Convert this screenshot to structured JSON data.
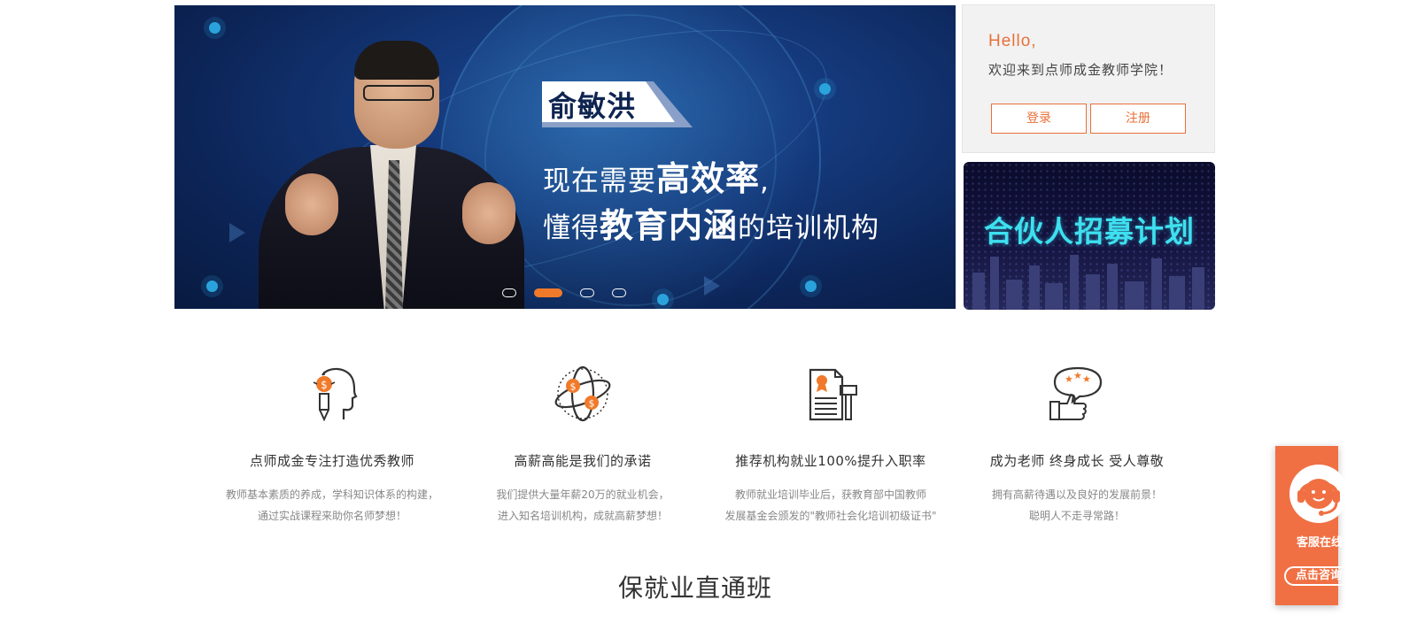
{
  "banner": {
    "name": "俞敏洪",
    "slogan_line1_pre": "现在需要",
    "slogan_line1_bold": "高效率",
    "slogan_line1_post": ",",
    "slogan_line2_pre": "懂得",
    "slogan_line2_bold": "教育内涵",
    "slogan_line2_post": "的培训机构",
    "slides": 4,
    "active_slide": 2
  },
  "login": {
    "hello": "Hello,",
    "welcome": "欢迎来到点师成金教师学院！",
    "login_label": "登录",
    "register_label": "注册"
  },
  "partner": {
    "title": "合伙人招募计划"
  },
  "features": [
    {
      "icon": "head-idea-icon",
      "title": "点师成金专注打造优秀教师",
      "desc_line1": "教师基本素质的养成，学科知识体系的构建，",
      "desc_line2": "通过实战课程来助你名师梦想！"
    },
    {
      "icon": "globe-money-icon",
      "title": "高薪高能是我们的承诺",
      "desc_line1": "我们提供大量年薪20万的就业机会，",
      "desc_line2": "进入知名培训机构，成就高薪梦想！"
    },
    {
      "icon": "certificate-icon",
      "title": "推荐机构就业100%提升入职率",
      "desc_line1": "教师就业培训毕业后，获教育部中国教师",
      "desc_line2": "发展基金会颁发的\"教师社会化培训初级证书\""
    },
    {
      "icon": "rating-thumbs-up-icon",
      "title": "成为老师 终身成长 受人尊敬",
      "desc_line1": "拥有高薪待遇以及良好的发展前景！",
      "desc_line2": "聪明人不走寻常路！"
    }
  ],
  "section": {
    "title": "保就业直通班"
  },
  "service": {
    "label": "客服在线",
    "consult": "点击咨询"
  },
  "colors": {
    "accent": "#e8703a",
    "service_bg": "#f07043",
    "banner_bg": "#14387a",
    "partner_title": "#3ee0f0"
  }
}
